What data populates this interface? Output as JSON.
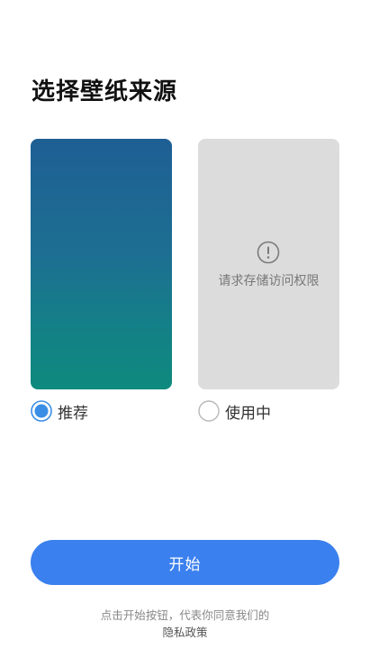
{
  "page": {
    "title": "选择壁纸来源"
  },
  "cards": {
    "current": {
      "permission_text": "请求存储访问权限",
      "icon": "exclamation-circle-icon"
    }
  },
  "options": {
    "recommended": {
      "label": "推荐",
      "selected": true
    },
    "current": {
      "label": "使用中",
      "selected": false
    }
  },
  "start_button": {
    "label": "开始"
  },
  "agreement": {
    "text": "点击开始按钮，代表你同意我们的",
    "link": "隐私政策"
  },
  "colors": {
    "accent": "#3a80ee",
    "radio_selected": "#3a8ee6",
    "card_gradient_top": "#1e5f94",
    "card_gradient_bottom": "#0e8a7e",
    "card_placeholder": "#dcdcdc"
  }
}
